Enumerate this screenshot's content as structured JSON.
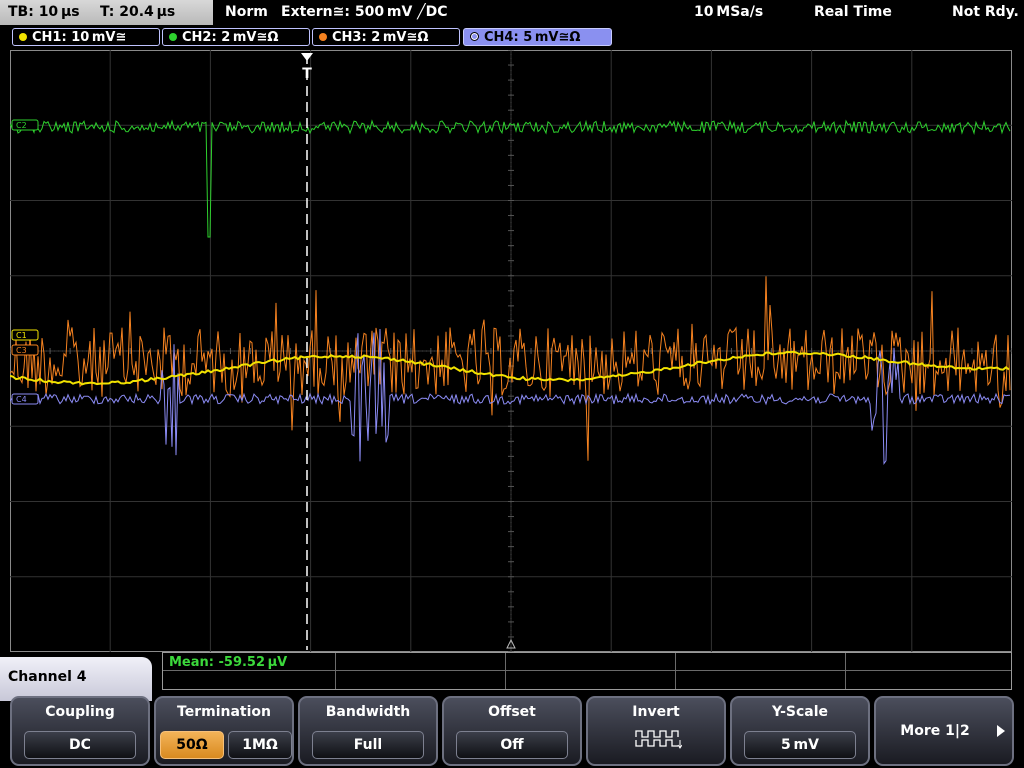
{
  "status": {
    "timebase": "TB: 10 µs",
    "trigger_pos": "T: 20.4 µs",
    "mode": "Norm",
    "trigger_source": "Extern≅: 500 mV ╱DC",
    "sample_rate": "10 MSa/s",
    "acq_mode": "Real Time",
    "state": "Not Rdy."
  },
  "channels": [
    {
      "label": "CH1: 10 mV≅",
      "color": "#f2e300"
    },
    {
      "label": "CH2: 2 mV≅Ω",
      "color": "#2ed12e"
    },
    {
      "label": "CH3: 2 mV≅Ω",
      "color": "#f58220"
    },
    {
      "label": "CH4: 5 mV≅Ω",
      "color": "#8c8cf5"
    }
  ],
  "markers": {
    "trigger": "T",
    "ch2": "C2",
    "ch1": "C1",
    "ch3": "C3",
    "ch4": "C4"
  },
  "measurement": {
    "mean": "Mean: -59.52 µV"
  },
  "channel_panel": {
    "title": "Channel 4"
  },
  "softkeys": {
    "coupling": {
      "title": "Coupling",
      "value": "DC"
    },
    "termination": {
      "title": "Termination",
      "option_a": "50Ω",
      "option_b": "1MΩ",
      "selected": "50Ω"
    },
    "bandwidth": {
      "title": "Bandwidth",
      "value": "Full"
    },
    "offset": {
      "title": "Offset",
      "value": "Off"
    },
    "invert": {
      "title": "Invert"
    },
    "yscale": {
      "title": "Y-Scale",
      "value": "5 mV"
    },
    "more": {
      "title": "More 1|2"
    }
  }
}
